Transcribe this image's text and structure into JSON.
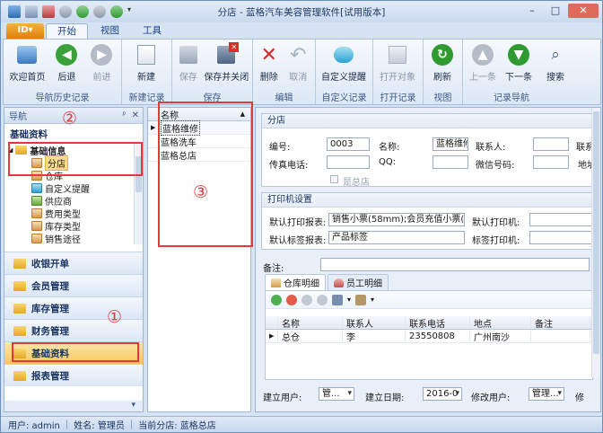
{
  "window": {
    "title": "分店 - 蓝格汽车美容管理软件[试用版本]",
    "app_button": "ID▾",
    "tabs": [
      {
        "label": "开始"
      },
      {
        "label": "视图"
      },
      {
        "label": "工具"
      }
    ]
  },
  "ribbon": {
    "groups": [
      {
        "label": "导航历史记录",
        "buttons": [
          {
            "label": "欢迎首页",
            "icon": "home-icon"
          },
          {
            "label": "后退",
            "icon": "back-icon"
          },
          {
            "label": "前进",
            "icon": "forward-icon"
          }
        ]
      },
      {
        "label": "新建记录",
        "buttons": [
          {
            "label": "新建",
            "icon": "new-record-icon"
          }
        ]
      },
      {
        "label": "保存",
        "buttons": [
          {
            "label": "保存",
            "icon": "save-icon"
          },
          {
            "label": "保存并关闭",
            "icon": "save-close-icon"
          }
        ]
      },
      {
        "label": "编辑",
        "buttons": [
          {
            "label": "删除",
            "icon": "delete-icon"
          },
          {
            "label": "取消",
            "icon": "undo-icon"
          }
        ]
      },
      {
        "label": "自定义记录",
        "buttons": [
          {
            "label": "自定义提醒",
            "icon": "reminder-icon"
          }
        ]
      },
      {
        "label": "打开记录",
        "buttons": [
          {
            "label": "打开对象",
            "icon": "open-object-icon"
          }
        ]
      },
      {
        "label": "视图",
        "buttons": [
          {
            "label": "刷新",
            "icon": "refresh-icon"
          }
        ]
      },
      {
        "label": "记录导航",
        "buttons": [
          {
            "label": "上一条",
            "icon": "up-icon"
          },
          {
            "label": "下一条",
            "icon": "down-icon"
          },
          {
            "label": "搜索",
            "icon": "search-icon"
          }
        ]
      }
    ]
  },
  "nav": {
    "header": "导航",
    "pin": "ᵖ",
    "close": "✕",
    "section_title": "基础资料",
    "tree": [
      {
        "label": "基础信息",
        "level": 0,
        "type": "folder"
      },
      {
        "label": "分店",
        "level": 1,
        "type": "leaf",
        "selected": true
      },
      {
        "label": "仓库",
        "level": 1,
        "type": "leaf"
      },
      {
        "label": "自定义提醒",
        "level": 1,
        "type": "leaf"
      },
      {
        "label": "供应商",
        "level": 1,
        "type": "leaf"
      },
      {
        "label": "费用类型",
        "level": 1,
        "type": "leaf"
      },
      {
        "label": "库存类型",
        "level": 1,
        "type": "leaf"
      },
      {
        "label": "销售途径",
        "level": 1,
        "type": "leaf"
      }
    ],
    "groups": [
      {
        "label": "收银开单"
      },
      {
        "label": "会员管理"
      },
      {
        "label": "库存管理"
      },
      {
        "label": "财务管理"
      },
      {
        "label": "基础资料",
        "active": true
      },
      {
        "label": "报表管理"
      }
    ],
    "footer": "▾"
  },
  "annotations": {
    "one": "①",
    "two": "②",
    "three": "③"
  },
  "grid": {
    "header": "名称",
    "sort": "▲",
    "rows": [
      "蓝格维修",
      "蓝格洗车",
      "蓝格总店"
    ]
  },
  "detail": {
    "section_store": "分店",
    "labels": {
      "code": "编号:",
      "name": "名称:",
      "contact": "联系人:",
      "contact2": "联系",
      "fax": "传真电话:",
      "qq": "QQ:",
      "wechat": "微信号码:",
      "address": "地址",
      "is_hq": "是总店"
    },
    "values": {
      "code": "0003",
      "name": "蓝格维修"
    },
    "section_printer": "打印机设置",
    "printer": {
      "default_report_label": "默认打印报表:",
      "default_report_value": "销售小票(58mm);会员充值小票(58",
      "default_printer_label": "默认打印机:",
      "default_tag_label": "默认标签报表:",
      "default_tag_value": "产品标签",
      "tag_printer_label": "标签打印机:"
    },
    "remark_label": "备注:",
    "subtabs": [
      {
        "label": "仓库明细"
      },
      {
        "label": "员工明细"
      }
    ],
    "table": {
      "columns": [
        "名称",
        "联系人",
        "联系电话",
        "地点",
        "备注"
      ],
      "rows": [
        [
          "总仓",
          "李",
          "23550808",
          "广州南沙",
          ""
        ]
      ]
    },
    "bottom": {
      "creator_label": "建立用户:",
      "creator_value": "管...",
      "created_label": "建立日期:",
      "created_value": "2016-0",
      "modifier_label": "修改用户:",
      "modifier_value": "管理...",
      "modified_label": "修"
    }
  },
  "status": {
    "user": "用户: admin",
    "name": "姓名: 管理员",
    "store": "当前分店: 蓝格总店"
  }
}
